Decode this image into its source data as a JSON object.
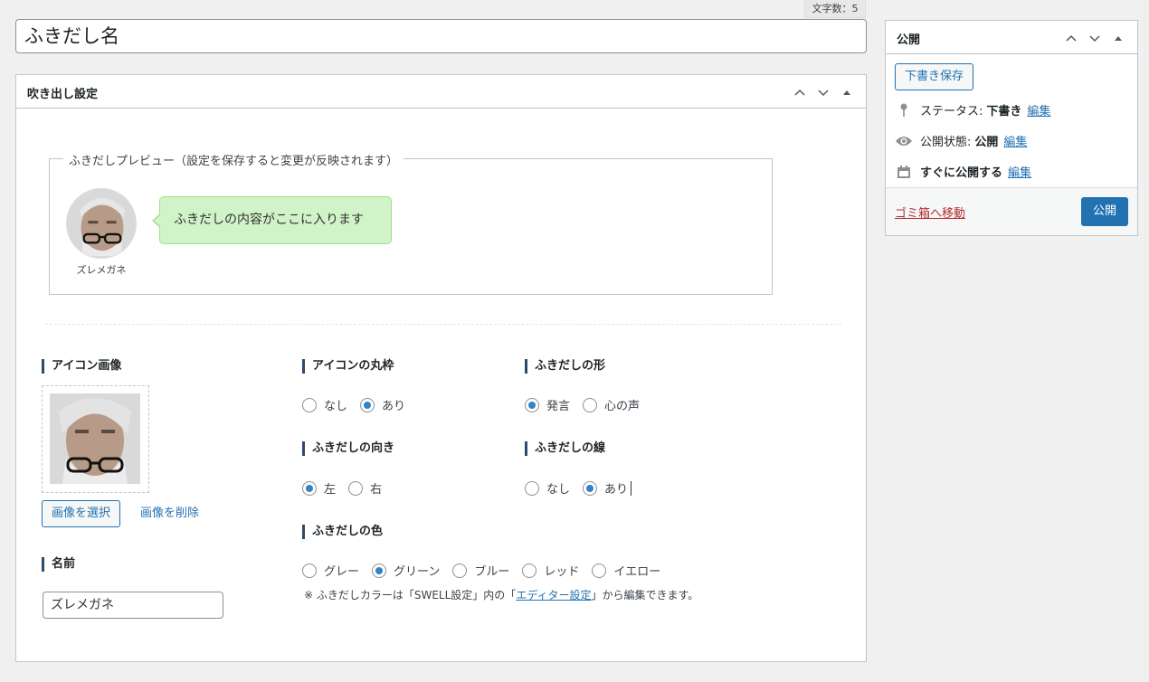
{
  "char_count": "文字数：5",
  "title_input": {
    "value": "ふきだし名"
  },
  "main_box": {
    "title": "吹き出し設定",
    "preview": {
      "legend": "ふきだしプレビュー（設定を保存すると変更が反映されます）",
      "avatar_name": "ズレメガネ",
      "bubble_text": "ふきだしの内容がここに入ります",
      "bubble_color": "#d1f3c9",
      "bubble_border": "#9be287"
    },
    "icon_image": {
      "label": "アイコン画像",
      "select_button": "画像を選択",
      "delete_link": "画像を削除"
    },
    "name": {
      "label": "名前",
      "value": "ズレメガネ"
    },
    "icon_round": {
      "label": "アイコンの丸枠",
      "options": [
        {
          "label": "なし",
          "checked": false
        },
        {
          "label": "あり",
          "checked": true
        }
      ]
    },
    "direction": {
      "label": "ふきだしの向き",
      "options": [
        {
          "label": "左",
          "checked": true
        },
        {
          "label": "右",
          "checked": false
        }
      ]
    },
    "shape": {
      "label": "ふきだしの形",
      "options": [
        {
          "label": "発言",
          "checked": true
        },
        {
          "label": "心の声",
          "checked": false
        }
      ]
    },
    "line": {
      "label": "ふきだしの線",
      "options": [
        {
          "label": "なし",
          "checked": false
        },
        {
          "label": "あり",
          "checked": true
        }
      ]
    },
    "color": {
      "label": "ふきだしの色",
      "options": [
        {
          "label": "グレー",
          "checked": false
        },
        {
          "label": "グリーン",
          "checked": true
        },
        {
          "label": "ブルー",
          "checked": false
        },
        {
          "label": "レッド",
          "checked": false
        },
        {
          "label": "イエロー",
          "checked": false
        }
      ],
      "note_before": "※ ふきだしカラーは「SWELL設定」内の「",
      "note_link": "エディター設定",
      "note_after": "」から編集できます。"
    }
  },
  "publish_box": {
    "title": "公開",
    "save_draft": "下書き保存",
    "status_label": "ステータス:",
    "status_value": "下書き",
    "visibility_label": "公開状態:",
    "visibility_value": "公開",
    "schedule_label": "すぐに公開する",
    "edit_link": "編集",
    "trash_link": "ゴミ箱へ移動",
    "publish_button": "公開"
  },
  "colors": {
    "accent": "#2271b1",
    "radio_checked": "#3582c4",
    "trash": "#b32d2e",
    "label_bar": "#2e4a6a"
  }
}
